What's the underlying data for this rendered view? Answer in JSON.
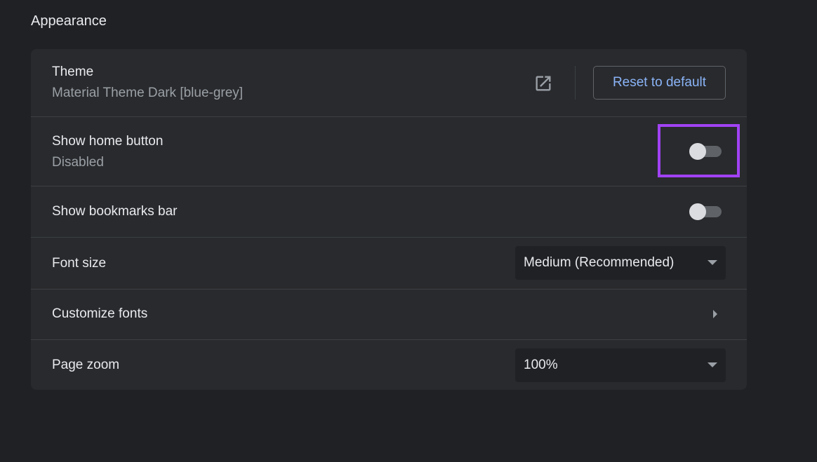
{
  "section": {
    "title": "Appearance"
  },
  "theme": {
    "label": "Theme",
    "value": "Material Theme Dark [blue-grey]",
    "open_icon": "open-in-new-icon",
    "reset_label": "Reset to default"
  },
  "home_button": {
    "label": "Show home button",
    "status": "Disabled",
    "enabled": false,
    "highlight_color": "#a142f4"
  },
  "bookmarks_bar": {
    "label": "Show bookmarks bar",
    "enabled": false
  },
  "font_size": {
    "label": "Font size",
    "selected": "Medium (Recommended)"
  },
  "customize_fonts": {
    "label": "Customize fonts",
    "icon": "chevron-right-icon"
  },
  "page_zoom": {
    "label": "Page zoom",
    "selected": "100%"
  },
  "colors": {
    "background": "#202124",
    "card": "#292a2d",
    "accent": "#8ab4f8",
    "divider": "#3c4043"
  }
}
